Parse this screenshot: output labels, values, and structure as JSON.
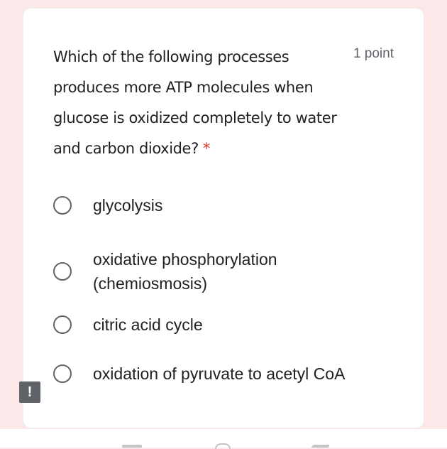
{
  "question": {
    "text": "Which of the following processes produces more ATP molecules when glucose is oxidized completely to water and carbon dioxide?",
    "required_marker": "*",
    "points": "1 point"
  },
  "options": [
    {
      "label": "glycolysis"
    },
    {
      "label": "oxidative phosphorylation\n(chemiosmosis)"
    },
    {
      "label": "citric acid cycle"
    },
    {
      "label": "oxidation of pyruvate to acetyl CoA"
    }
  ],
  "alert_badge": {
    "text": "!"
  },
  "colors": {
    "background": "#fce8e8",
    "card": "#ffffff",
    "required": "#d93025",
    "radio_border": "#5f6368",
    "text": "#202124"
  },
  "icons": [
    "alert-icon",
    "recents-icon",
    "home-icon",
    "back-icon"
  ]
}
